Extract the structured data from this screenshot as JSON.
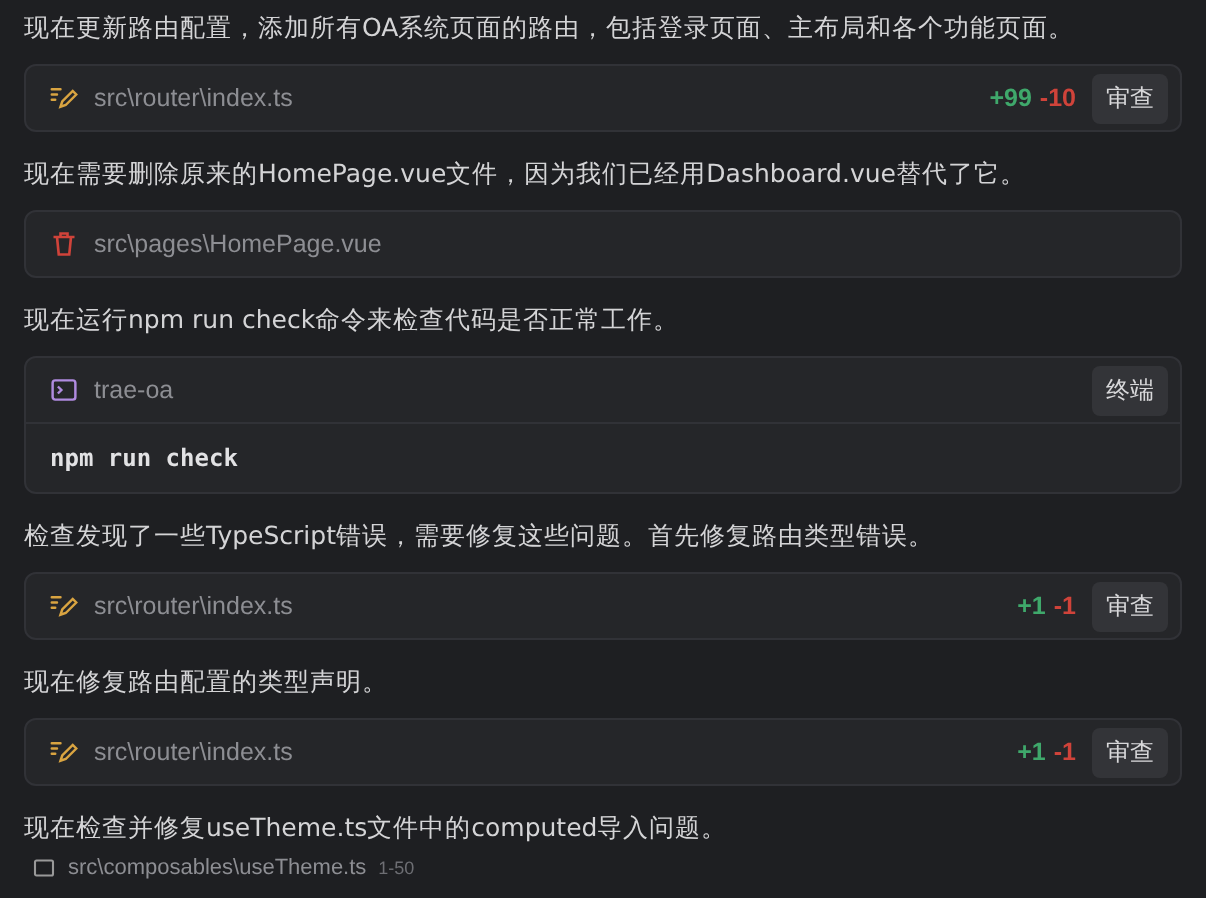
{
  "items": [
    {
      "kind": "message",
      "text": "现在更新路由配置，添加所有OA系统页面的路由，包括登录页面、主布局和各个功能页面。"
    },
    {
      "kind": "edit",
      "path": "src\\router\\index.ts",
      "added": "+99",
      "removed": "-10",
      "button": "审查"
    },
    {
      "kind": "message",
      "text": "现在需要删除原来的HomePage.vue文件，因为我们已经用Dashboard.vue替代了它。"
    },
    {
      "kind": "delete",
      "path": "src\\pages\\HomePage.vue"
    },
    {
      "kind": "message",
      "text": "现在运行npm run check命令来检查代码是否正常工作。"
    },
    {
      "kind": "terminal",
      "name": "trae-oa",
      "button": "终端",
      "command": "npm run check"
    },
    {
      "kind": "message",
      "text": "检查发现了一些TypeScript错误，需要修复这些问题。首先修复路由类型错误。"
    },
    {
      "kind": "edit",
      "path": "src\\router\\index.ts",
      "added": "+1",
      "removed": "-1",
      "button": "审查"
    },
    {
      "kind": "message",
      "text": "现在修复路由配置的类型声明。"
    },
    {
      "kind": "edit",
      "path": "src\\router\\index.ts",
      "added": "+1",
      "removed": "-1",
      "button": "审查"
    },
    {
      "kind": "message",
      "text": "现在检查并修复useTheme.ts文件中的computed导入问题。"
    },
    {
      "kind": "file_ref",
      "path": "src\\composables\\useTheme.ts",
      "range": "1-50"
    }
  ]
}
